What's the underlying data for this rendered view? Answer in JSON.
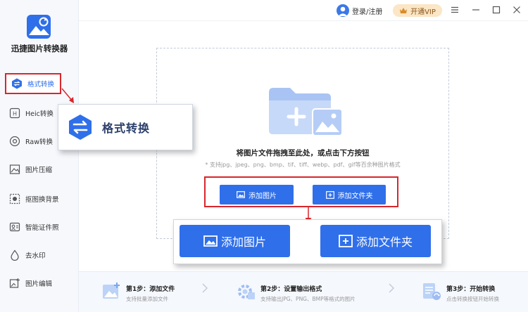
{
  "app": {
    "name": "迅捷图片转换器",
    "accent_color": "#2f6fea",
    "highlight_color": "#d9262c"
  },
  "sidebar": {
    "items": [
      {
        "label": "格式转换",
        "icon": "swap-icon",
        "active": true
      },
      {
        "label": "Heic转换",
        "icon": "heic-icon"
      },
      {
        "label": "Raw转换",
        "icon": "raw-icon"
      },
      {
        "label": "图片压缩",
        "icon": "image-compress-icon"
      },
      {
        "label": "抠图换背景",
        "icon": "cutout-icon"
      },
      {
        "label": "智能证件照",
        "icon": "id-photo-icon"
      },
      {
        "label": "去水印",
        "icon": "watermark-icon"
      },
      {
        "label": "图片编辑",
        "icon": "image-edit-icon"
      }
    ]
  },
  "topbar": {
    "login_label": "登录/注册",
    "vip_label": "开通VIP"
  },
  "dropzone": {
    "title": "将图片文件拖拽至此处，或点击下方按钮",
    "subtitle": "* 支持jpg、jpeg、png、bmp、tif、tiff、webp、pdf、gif等百余种图片格式",
    "add_image_label": "添加图片",
    "add_folder_label": "添加文件夹"
  },
  "callout": {
    "format_label": "格式转换",
    "add_image_label": "添加图片",
    "add_folder_label": "添加文件夹"
  },
  "steps": [
    {
      "title": "第1步：添加文件",
      "desc": "支持批量添加文件"
    },
    {
      "title": "第2步：设置输出格式",
      "desc": "支持输出JPG、PNG、BMP等格式的图片"
    },
    {
      "title": "第3步：开始转换",
      "desc": "点击转换按钮开始转换"
    }
  ]
}
